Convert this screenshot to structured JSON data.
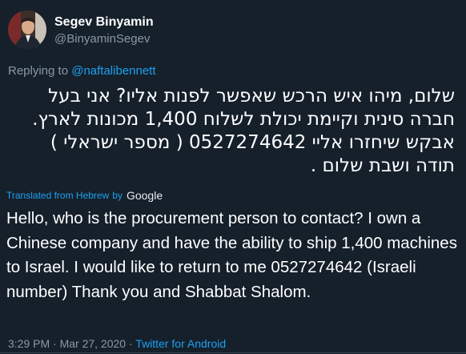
{
  "author": {
    "display_name": "Segev Binyamin",
    "handle": "@BinyaminSegev"
  },
  "replying": {
    "prefix": "Replying to ",
    "mention": "@naftalibennett"
  },
  "tweet": {
    "original_text": "שלום, מיהו איש הרכש שאפשר לפנות אליו? אני בעל חברה סינית וקיימת יכולת לשלוח 1,400 מכונות לארץ. אבקש שיחזרו אליי 0527274642 ( מספר ישראלי ) תודה ושבת שלום .",
    "translated_label": "Translated from Hebrew",
    "translated_by": "by",
    "translator": "Google",
    "translated_text": "Hello, who is the procurement person to contact? I own a Chinese company and have the ability to ship 1,400 machines to Israel. I would like to return to me 0527274642 (Israeli number) Thank you and Shabbat Shalom."
  },
  "meta": {
    "time": "3:29 PM",
    "date": "Mar 27, 2020",
    "client": "Twitter for Android",
    "separator": "·"
  },
  "colors": {
    "background": "#15202b",
    "secondary_text": "#8899a6",
    "link": "#1da1f2"
  },
  "icons": {
    "avatar": "profile-photo"
  }
}
